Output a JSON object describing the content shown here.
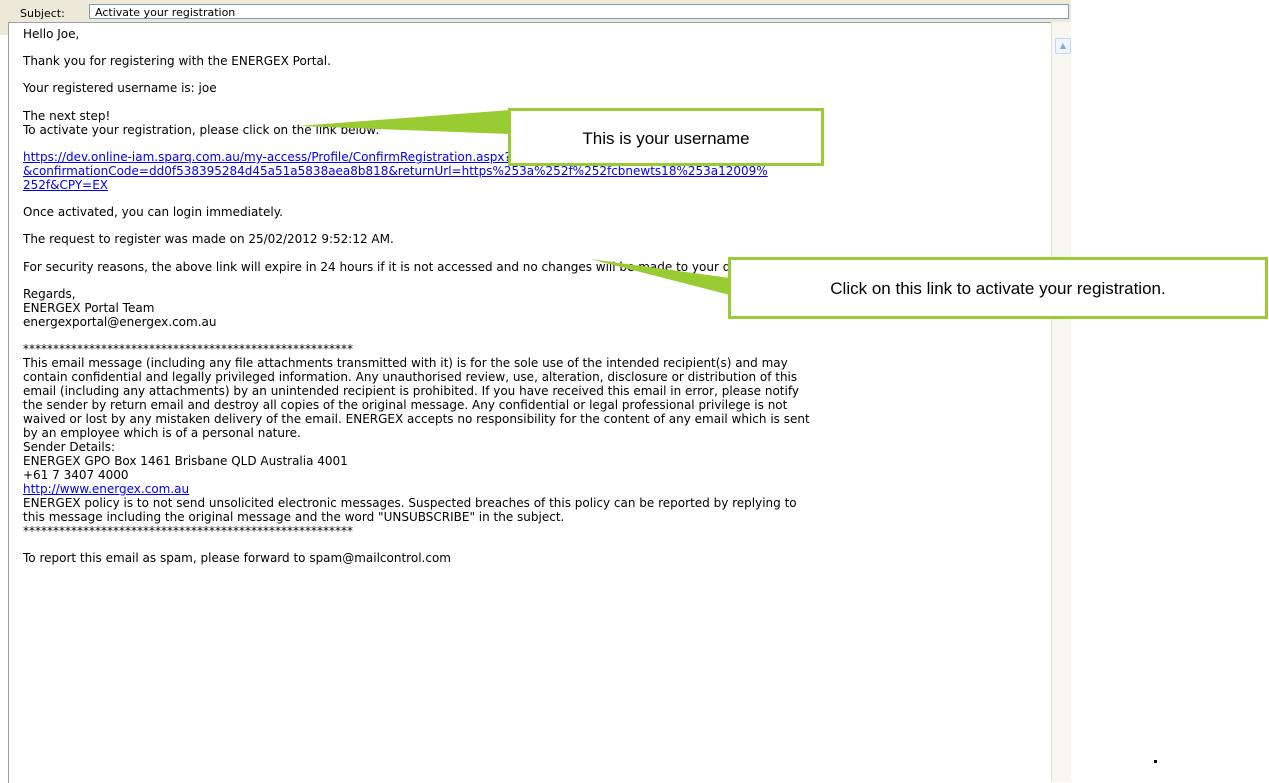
{
  "header": {
    "subject_label": "Subject:",
    "subject_value": "Activate your registration"
  },
  "email": {
    "greeting": "Hello Joe,",
    "thanks": "Thank you for registering with the ENERGEX Portal.",
    "username_line": "Your registered username is: joe",
    "next_step": "The next step!",
    "activate_instruction": "To activate your registration, please click on the link below:",
    "link_lines": [
      "https://dev.online-iam.sparq.com.au/my-access/Profile/ConfirmRegistration.aspx?userName=susan08",
      "&confirmationCode=dd0f538395284d45a51a5838aea8b818&returnUrl=https%253a%252f%252fcbnewts18%253a12009%",
      "252f&CPY=EX"
    ],
    "once_activated": "Once activated, you can login immediately.",
    "request_made": "The request to register was made on 25/02/2012 9:52:12 AM.",
    "security_note": "For security reasons, the above link will expire in 24 hours if it is not accessed and no changes will be made to your details.",
    "regards": "Regards,",
    "team": "ENERGEX Portal Team",
    "team_email": "energexportal@energex.com.au",
    "separator": "*******************************************************",
    "disclaimer_lines": [
      "This email message (including any file attachments transmitted with it) is for the sole use of the intended recipient(s) and may",
      "contain confidential and legally privileged information. Any unauthorised review, use, alteration, disclosure or distribution of this",
      "email (including any attachments) by an unintended recipient is prohibited. If you have received this email in error, please notify",
      "the sender by return email and destroy all copies of the original message. Any confidential or legal professional privilege is not",
      "waived or lost by any mistaken delivery of the email. ENERGEX accepts no responsibility for the content of any email which is sent",
      "by an employee which is of a personal nature."
    ],
    "sender_details": "Sender Details:",
    "address": "ENERGEX GPO Box 1461 Brisbane QLD Australia 4001",
    "phone": "+61 7 3407 4000",
    "website": "http://www.energex.com.au",
    "policy_lines": [
      "ENERGEX policy is to not send unsolicited electronic messages. Suspected breaches of this policy can be reported by replying to",
      "this message including the original message and the word \"UNSUBSCRIBE\" in the subject."
    ],
    "separator_end": "*******************************************************",
    "spam_note": "To report this email as spam, please forward to spam@mailcontrol.com"
  },
  "callouts": {
    "username": "This is your username",
    "link": "Click on this link to activate your registration."
  },
  "colors": {
    "callout_border": "#99cc33",
    "link": "#0000ee"
  },
  "icons": {
    "scroll_up": "chevron-up-icon"
  }
}
